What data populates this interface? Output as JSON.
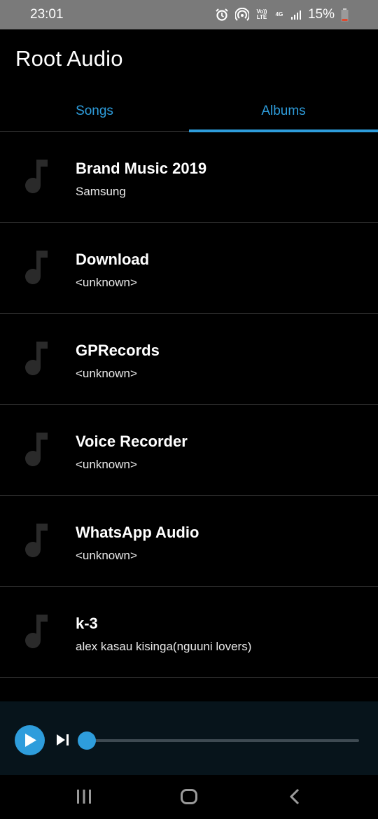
{
  "status_bar": {
    "time": "23:01",
    "icons": [
      "alarm-icon",
      "hotspot-icon",
      "volte-icon",
      "4g-icon",
      "signal-icon",
      "battery-icon"
    ],
    "volte_label": "Vo)) LTE",
    "network_label": "4G",
    "battery": "15%"
  },
  "app": {
    "title": "Root Audio"
  },
  "tabs": [
    {
      "label": "Songs",
      "selected": false
    },
    {
      "label": "Albums",
      "selected": true
    }
  ],
  "albums": [
    {
      "title": "Brand Music 2019",
      "artist": "Samsung"
    },
    {
      "title": "Download",
      "artist": "<unknown>"
    },
    {
      "title": "GPRecords",
      "artist": "<unknown>"
    },
    {
      "title": "Voice Recorder",
      "artist": "<unknown>"
    },
    {
      "title": "WhatsApp Audio",
      "artist": "<unknown>"
    },
    {
      "title": "k-3",
      "artist": "alex kasau kisinga(nguuni lovers)"
    }
  ],
  "player": {
    "icons": [
      "play-icon",
      "skip-next-icon"
    ],
    "progress": 0
  },
  "nav_bar": {
    "icons": [
      "recents-icon",
      "home-icon",
      "back-icon"
    ]
  },
  "colors": {
    "accent": "#2e9ddc",
    "background": "#000000",
    "status_bar": "#7a7a7a",
    "player_bg": "#07141b"
  }
}
